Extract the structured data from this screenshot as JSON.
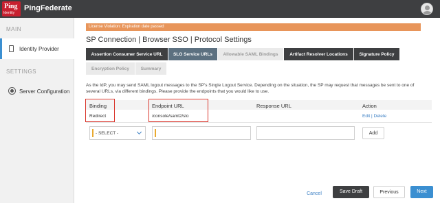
{
  "header": {
    "logo_mark": "Ping",
    "logo_mark_sub": "Identity",
    "product_name": "PingFederate",
    "user_icon": "user-avatar-icon"
  },
  "sidebar": {
    "sections": [
      {
        "title": "MAIN",
        "items": [
          {
            "label": "Identity Provider",
            "icon": "document-icon",
            "active": true
          }
        ]
      },
      {
        "title": "SETTINGS",
        "items": [
          {
            "label": "Server Configuration",
            "icon": "gear-icon",
            "active": false
          }
        ]
      }
    ]
  },
  "banner": {
    "text": "License Violation: Expiration date passed",
    "color": "#e8955a"
  },
  "page": {
    "title": "SP Connection | Browser SSO | Protocol Settings"
  },
  "tabs": [
    {
      "label": "Assertion Consumer Service URL",
      "state": "normal"
    },
    {
      "label": "SLO Service URLs",
      "state": "active"
    },
    {
      "label": "Allowable SAML Bindings",
      "state": "disabled"
    },
    {
      "label": "Artifact Resolver Locations",
      "state": "normal"
    },
    {
      "label": "Signature Policy",
      "state": "normal"
    },
    {
      "label": "Encryption Policy",
      "state": "disabled"
    },
    {
      "label": "Summary",
      "state": "disabled"
    }
  ],
  "description": "As the IdP, you may send SAML logout messages to the SP's Single Logout Service. Depending on the situation, the SP may request that messages be sent to one of several URLs, via different bindings. Please provide the endpoints that you would like to use.",
  "table": {
    "columns": [
      "Binding",
      "Endpoint URL",
      "Response URL",
      "Action"
    ],
    "rows": [
      {
        "binding": "Redirect",
        "endpoint_url": "/console/saml2/slo",
        "response_url": "",
        "action": "Edit | Delete"
      }
    ],
    "new_row": {
      "binding_select": "- SELECT -",
      "endpoint_url": "",
      "response_url": "",
      "add_label": "Add"
    }
  },
  "footer": {
    "cancel": "Cancel",
    "save_draft": "Save Draft",
    "previous": "Previous",
    "next": "Next"
  },
  "colors": {
    "accent": "#3b8fd1",
    "topbar": "#3e3f41",
    "highlight": "#d9342a",
    "required": "#e9a92e"
  }
}
